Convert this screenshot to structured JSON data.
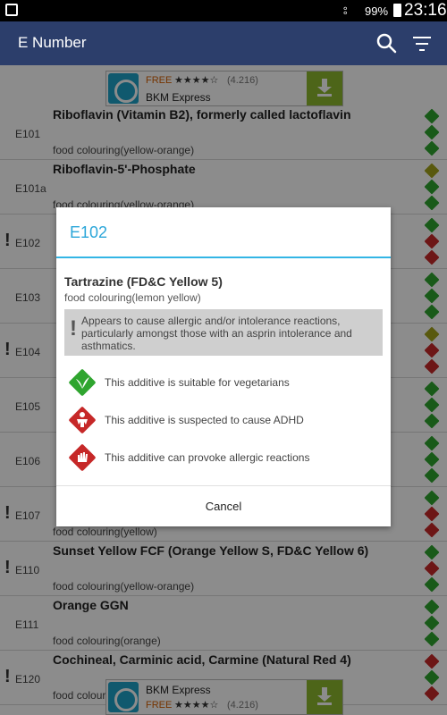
{
  "status_bar": {
    "battery": "99%",
    "time": "23:16"
  },
  "app_bar": {
    "title": "E Number"
  },
  "list": [
    {
      "code": "E101",
      "warn": false,
      "name": "Riboflavin (Vitamin B2), formerly called lactoflavin",
      "category": "food colouring(yellow-orange)",
      "icons": [
        "green",
        "green",
        "green"
      ]
    },
    {
      "code": "E101a",
      "warn": false,
      "name": "Riboflavin-5'-Phosphate",
      "category": "food colouring(yellow-orange)",
      "icons": [
        "olive",
        "green",
        "green"
      ]
    },
    {
      "code": "E102",
      "warn": true,
      "name": "",
      "category": "",
      "icons": [
        "green",
        "red",
        "red"
      ]
    },
    {
      "code": "E103",
      "warn": false,
      "name": "",
      "category": "",
      "icons": [
        "green",
        "green",
        "green"
      ]
    },
    {
      "code": "E104",
      "warn": true,
      "name": "",
      "category": "",
      "icons": [
        "olive",
        "red",
        "red"
      ]
    },
    {
      "code": "E105",
      "warn": false,
      "name": "",
      "category": "",
      "icons": [
        "green",
        "green",
        "green"
      ]
    },
    {
      "code": "E106",
      "warn": false,
      "name": "",
      "category": "",
      "icons": [
        "green",
        "green",
        "green"
      ]
    },
    {
      "code": "E107",
      "warn": true,
      "name": "",
      "category": "food colouring(yellow)",
      "icons": [
        "green",
        "red",
        "red"
      ]
    },
    {
      "code": "E110",
      "warn": true,
      "name": "Sunset Yellow FCF (Orange Yellow S, FD&C Yellow 6)",
      "category": "food colouring(yellow-orange)",
      "icons": [
        "green",
        "red",
        "green"
      ]
    },
    {
      "code": "E111",
      "warn": false,
      "name": "Orange GGN",
      "category": "food colouring(orange)",
      "icons": [
        "green",
        "green",
        "green"
      ]
    },
    {
      "code": "E120",
      "warn": true,
      "name": "Cochineal, Carminic acid, Carmine (Natural Red 4)",
      "category": "food colouring",
      "icons": [
        "red",
        "green",
        "red"
      ]
    }
  ],
  "ads": {
    "top": {
      "free": "FREE",
      "stars": "★★★★☆",
      "rating": "(4.216)",
      "title": "BKM Express"
    },
    "bottom": {
      "title": "BKM Express",
      "free": "FREE",
      "stars": "★★★★☆",
      "rating": "(4.216)"
    }
  },
  "dialog": {
    "title": "E102",
    "name": "Tartrazine (FD&C Yellow 5)",
    "category": "food colouring(lemon yellow)",
    "warning": "Appears to cause allergic and/or intolerance reactions, particularly amongst those with an asprin intolerance and asthmatics.",
    "properties": [
      {
        "icon": "vegetarian-leaf-icon",
        "text": "This additive is suitable for vegetarians",
        "color": "#2fa52f"
      },
      {
        "icon": "adhd-child-icon",
        "text": "This additive is suspected to cause ADHD",
        "color": "#c62828"
      },
      {
        "icon": "allergy-hand-icon",
        "text": "This additive can provoke allergic reactions",
        "color": "#c62828"
      }
    ],
    "cancel_label": "Cancel"
  }
}
